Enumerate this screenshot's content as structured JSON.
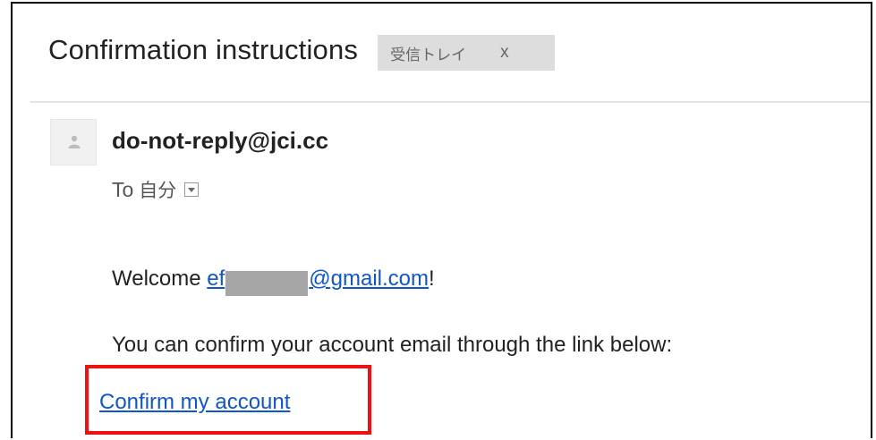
{
  "email": {
    "subject": "Confirmation instructions",
    "label": {
      "text": "受信トレイ",
      "remove": "x"
    },
    "sender": "do-not-reply@jci.cc",
    "to_label": "To",
    "recipient": "自分",
    "body": {
      "welcome_prefix": "Welcome ",
      "email_link_start": "ef",
      "email_link_end": "@gmail.com",
      "welcome_suffix": "!",
      "instruction": "You can confirm your account email through the link below:",
      "confirm_link": "Confirm my account"
    }
  },
  "colors": {
    "link": "#1155cc",
    "highlight": "#ee1111",
    "label_bg": "#dddddd"
  },
  "icons": {
    "avatar": "person-icon",
    "dropdown": "chevron-down-icon"
  }
}
